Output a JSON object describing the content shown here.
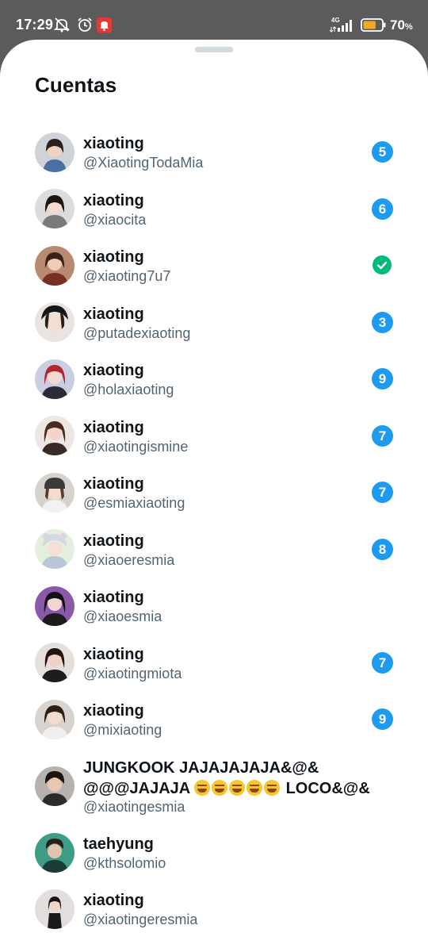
{
  "status_bar": {
    "time": "17:29",
    "network": "4G",
    "battery_percent": "70",
    "battery_unit": "%",
    "battery_level": 0.7,
    "battery_color": "#f5a623",
    "icons": [
      "mute-icon",
      "alarm-icon",
      "notification-app-icon",
      "signal-icon",
      "battery-icon"
    ]
  },
  "sheet": {
    "title": "Cuentas"
  },
  "accounts": [
    {
      "name": "xiaoting",
      "handle": "@XiaotingTodaMia",
      "badge": "5"
    },
    {
      "name": "xiaoting",
      "handle": "@xiaocita",
      "badge": "6"
    },
    {
      "name": "xiaoting",
      "handle": "@xiaoting7u7",
      "badge": "",
      "active": true
    },
    {
      "name": "xiaoting",
      "handle": "@putadexiaoting",
      "badge": "3"
    },
    {
      "name": "xiaoting",
      "handle": "@holaxiaoting",
      "badge": "9"
    },
    {
      "name": "xiaoting",
      "handle": "@xiaotingismine",
      "badge": "7"
    },
    {
      "name": "xiaoting",
      "handle": "@esmiaxiaoting",
      "badge": "7"
    },
    {
      "name": "xiaoting",
      "handle": "@xiaoeresmia",
      "badge": "8"
    },
    {
      "name": "xiaoting",
      "handle": "@xiaoesmia",
      "badge": ""
    },
    {
      "name": "xiaoting",
      "handle": "@xiaotingmiota",
      "badge": "7"
    },
    {
      "name": "xiaoting",
      "handle": "@mixiaoting",
      "badge": "9"
    },
    {
      "name_line1": "JUNGKOOK JAJAJAJAJA&@&",
      "name_line2_a": "@@@JAJAJA",
      "name_line2_b": "LOCO&@&",
      "handle": "@xiaotingesmia",
      "badge": ""
    },
    {
      "name": "taehyung",
      "handle": "@kthsolomio",
      "badge": ""
    },
    {
      "name": "xiaoting",
      "handle": "@xiaotingeresmia",
      "badge": ""
    }
  ],
  "colors": {
    "badge": "#1d9bf0",
    "active_check": "#00ba7c",
    "handle_text": "#536471",
    "name_text": "#0f1419"
  }
}
